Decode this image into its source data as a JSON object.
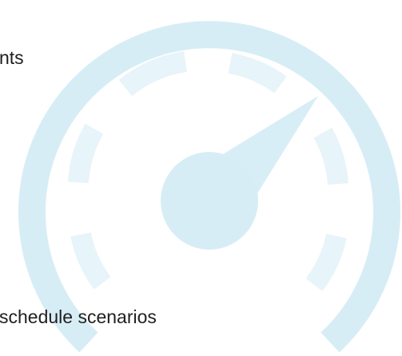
{
  "texts": {
    "line1": "nts",
    "line2": "schedule scenarios"
  },
  "icon": {
    "name": "speedometer-icon",
    "outer_color": "#d7edf6",
    "tick_color": "#e7f4fa",
    "needle_color": "#d8eef7"
  }
}
